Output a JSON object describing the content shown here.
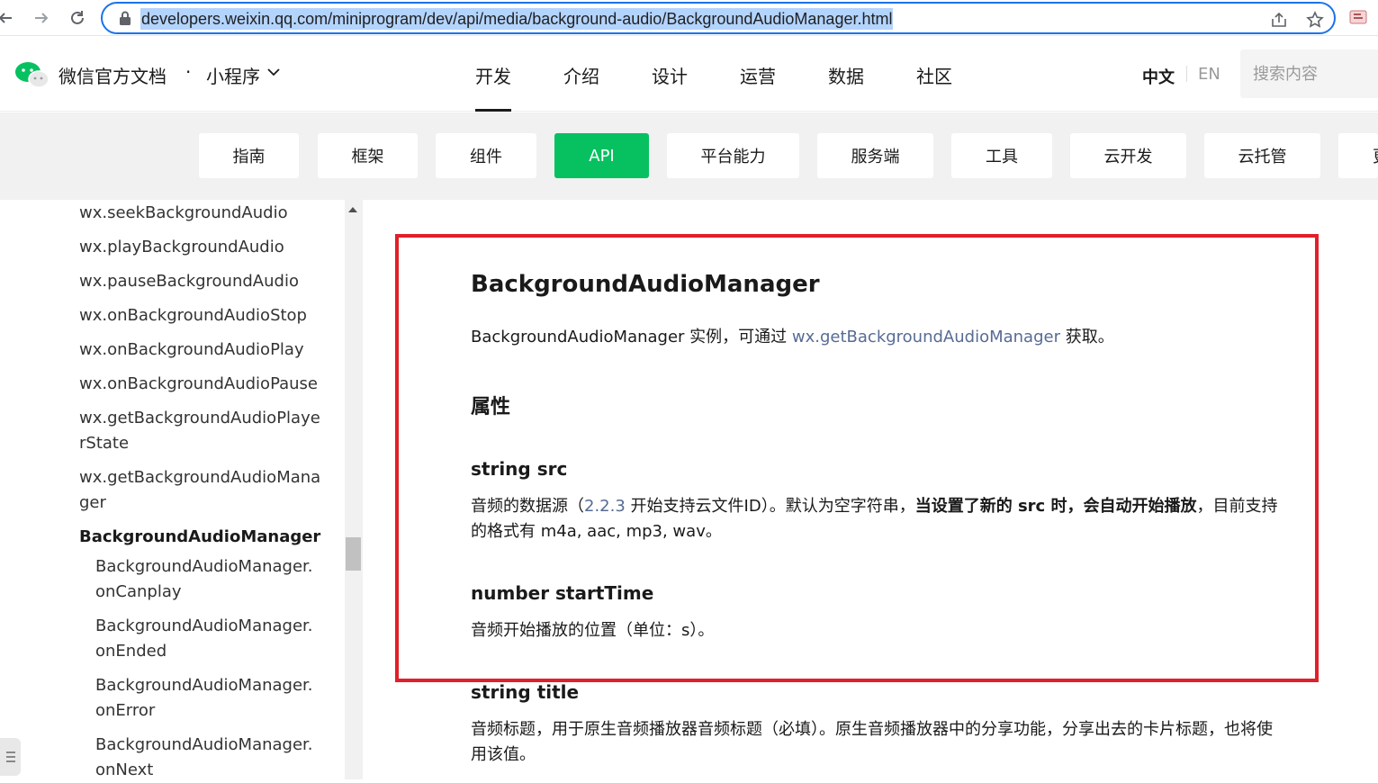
{
  "browser": {
    "url": "developers.weixin.qq.com/miniprogram/dev/api/media/background-audio/BackgroundAudioManager.html",
    "back_icon": "arrow-left-icon",
    "forward_icon": "arrow-right-icon",
    "reload_icon": "reload-icon"
  },
  "header": {
    "brand": "微信官方文档",
    "dot": "·",
    "subbrand": "小程序",
    "nav": [
      "开发",
      "介绍",
      "设计",
      "运营",
      "数据",
      "社区"
    ],
    "active_nav": "开发",
    "lang_zh": "中文",
    "lang_en": "EN",
    "search_placeholder": "搜索内容",
    "brand_color": "#07c160"
  },
  "categories": [
    "指南",
    "框架",
    "组件",
    "API",
    "平台能力",
    "服务端",
    "工具",
    "云开发",
    "云托管",
    "更"
  ],
  "active_category": "API",
  "sidebar": {
    "items": [
      "wx.seekBackgroundAudio",
      "wx.playBackgroundAudio",
      "wx.pauseBackgroundAudio",
      "wx.onBackgroundAudioStop",
      "wx.onBackgroundAudioPlay",
      "wx.onBackgroundAudioPause",
      "wx.getBackgroundAudioPlayerState",
      "wx.getBackgroundAudioManager",
      "BackgroundAudioManager"
    ],
    "sub_items": [
      "BackgroundAudioManager.onCanplay",
      "BackgroundAudioManager.onEnded",
      "BackgroundAudioManager.onError",
      "BackgroundAudioManager.onNext"
    ]
  },
  "content": {
    "title": "BackgroundAudioManager",
    "intro_prefix": "BackgroundAudioManager 实例，可通过 ",
    "intro_link": "wx.getBackgroundAudioManager",
    "intro_suffix": " 获取。",
    "section_title": "属性",
    "props": [
      {
        "name": "string src",
        "desc_1": "音频的数据源（",
        "desc_link": "2.2.3",
        "desc_2": " 开始支持云文件ID）。默认为空字符串，",
        "desc_bold": "当设置了新的 src 时，会自动开始播放",
        "desc_3": "，目前支持的格式有 m4a, aac, mp3, wav。"
      },
      {
        "name": "number startTime",
        "desc": "音频开始播放的位置（单位：s）。"
      },
      {
        "name": "string title",
        "desc": "音频标题，用于原生音频播放器音频标题（必填）。原生音频播放器中的分享功能，分享出去的卡片标题，也将使用该值。"
      }
    ],
    "highlight_color": "#e0202a"
  }
}
